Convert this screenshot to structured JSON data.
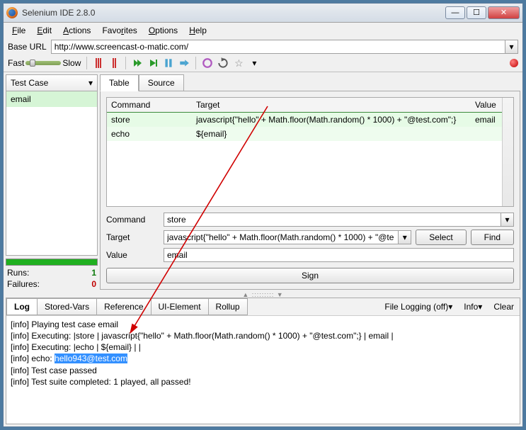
{
  "window": {
    "title": "Selenium IDE 2.8.0"
  },
  "menu": {
    "file": "File",
    "edit": "Edit",
    "actions": "Actions",
    "favorites": "Favorites",
    "options": "Options",
    "help": "Help"
  },
  "url": {
    "label": "Base URL",
    "value": "http://www.screencast-o-matic.com/"
  },
  "speed": {
    "fast": "Fast",
    "slow": "Slow"
  },
  "left": {
    "header": "Test Case",
    "items": [
      "email"
    ],
    "runs_label": "Runs:",
    "runs": "1",
    "failures_label": "Failures:",
    "failures": "0"
  },
  "tabs": {
    "table": "Table",
    "source": "Source"
  },
  "table": {
    "headers": {
      "command": "Command",
      "target": "Target",
      "value": "Value"
    },
    "rows": [
      {
        "command": "store",
        "target": "javascript{\"hello\" + Math.floor(Math.random() * 1000) + \"@test.com\";}",
        "value": "email"
      },
      {
        "command": "echo",
        "target": "${email}",
        "value": ""
      }
    ]
  },
  "editor": {
    "command_label": "Command",
    "command_value": "store",
    "target_label": "Target",
    "target_value": "javascript{\"hello\" + Math.floor(Math.random() * 1000) + \"@te",
    "value_label": "Value",
    "value_value": "email",
    "select": "Select",
    "find": "Find",
    "sign": "Sign"
  },
  "logtabs": {
    "log": "Log",
    "stored": "Stored-Vars",
    "reference": "Reference",
    "ui": "UI-Element",
    "rollup": "Rollup",
    "file_logging": "File Logging (off)",
    "info": "Info",
    "clear": "Clear"
  },
  "log": {
    "l1": "[info] Playing test case email",
    "l2": "[info] Executing: |store | javascript{\"hello\" + Math.floor(Math.random() * 1000) + \"@test.com\";} | email |",
    "l3": "[info] Executing: |echo | ${email} | |",
    "l4a": "[info] echo: ",
    "l4b": "hello943@test.com",
    "l5": "[info] Test case passed",
    "l6": "[info] Test suite completed: 1 played, all passed!"
  }
}
